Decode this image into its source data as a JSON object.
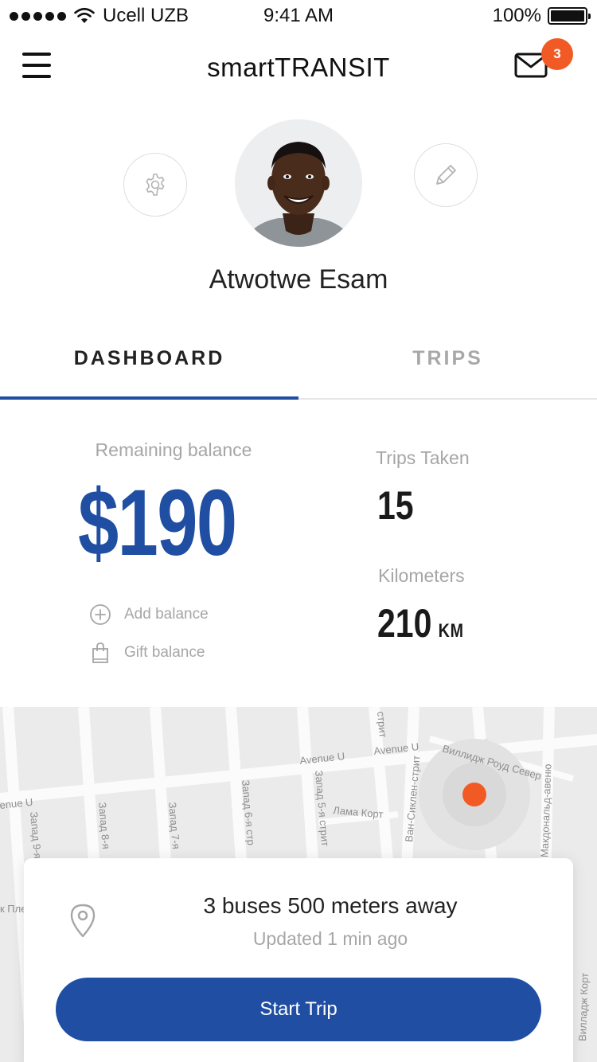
{
  "status_bar": {
    "carrier": "Ucell UZB",
    "time": "9:41 AM",
    "battery": "100%"
  },
  "nav": {
    "title": "smartTRANSIT",
    "menu_icon": "hamburger-menu-icon",
    "mail_icon": "mail-icon",
    "notification_count": "3",
    "badge_color": "#f15a24"
  },
  "profile": {
    "name": "Atwotwe Esam",
    "settings_icon": "gear-icon",
    "edit_icon": "pencil-icon"
  },
  "tabs": [
    {
      "label": "DASHBOARD",
      "active": true
    },
    {
      "label": "TRIPS",
      "active": false
    }
  ],
  "dashboard": {
    "balance_label": "Remaining balance",
    "balance_value": "$190",
    "add_balance_label": "Add balance",
    "gift_balance_label": "Gift balance",
    "trips_label": "Trips Taken",
    "trips_value": "15",
    "km_label": "Kilometers",
    "km_value": "210",
    "km_unit": "KM"
  },
  "map": {
    "streets": [
      "Avenue U",
      "Avenue U",
      "enue U",
      "стрит",
      "Виллидж Роуд Север",
      "Ван-Сиклен-стрит",
      "е Макдональд-авеню",
      "Запад 9-я",
      "Запад 8-я",
      "Запад 7-я",
      "Запад 6-я стр",
      "Запад 5-я стрит",
      "Лама Корт",
      "к Пле",
      "Вилладж Корт"
    ],
    "user_location_color": "#f15a24"
  },
  "trip_card": {
    "title": "3 buses 500 meters away",
    "updated": "Updated 1 min ago",
    "pin_icon": "location-pin-icon",
    "button_label": "Start Trip"
  },
  "colors": {
    "accent": "#1f4ea3",
    "muted_text": "#a6a6a6"
  }
}
